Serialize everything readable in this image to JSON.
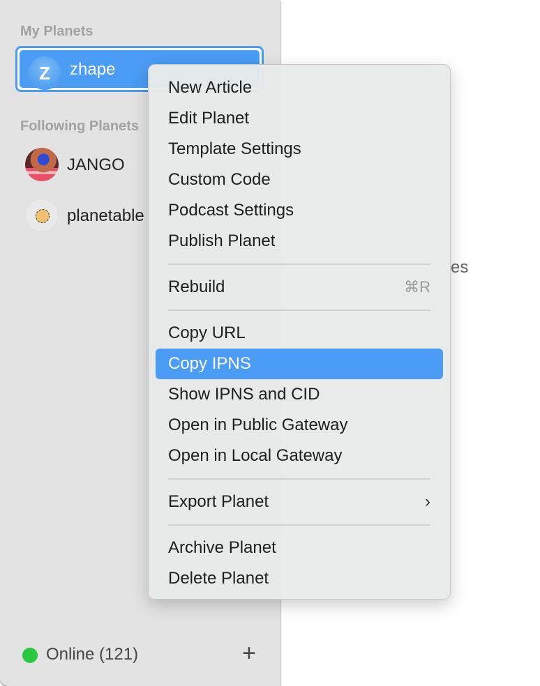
{
  "sidebar": {
    "my_planets_label": "My Planets",
    "my_planets": [
      {
        "initial": "Z",
        "name": "zhape"
      }
    ],
    "following_label": "Following Planets",
    "following": [
      {
        "name": "JANGO"
      },
      {
        "name": "planetable"
      }
    ],
    "status": {
      "label": "Online (121)",
      "color": "#2ac840"
    },
    "add_icon": "plus-icon"
  },
  "background_text": "es",
  "context_menu": {
    "groups": [
      [
        "New Article",
        "Edit Planet",
        "Template Settings",
        "Custom Code",
        "Podcast Settings",
        "Publish Planet"
      ],
      [
        "Rebuild"
      ],
      [
        "Copy URL",
        "Copy IPNS",
        "Show IPNS and CID",
        "Open in Public Gateway",
        "Open in Local Gateway"
      ],
      [
        "Export Planet"
      ],
      [
        "Archive Planet",
        "Delete Planet"
      ]
    ],
    "rebuild_shortcut": "⌘R",
    "highlighted": "Copy IPNS",
    "accent": "#4a9cf5"
  }
}
